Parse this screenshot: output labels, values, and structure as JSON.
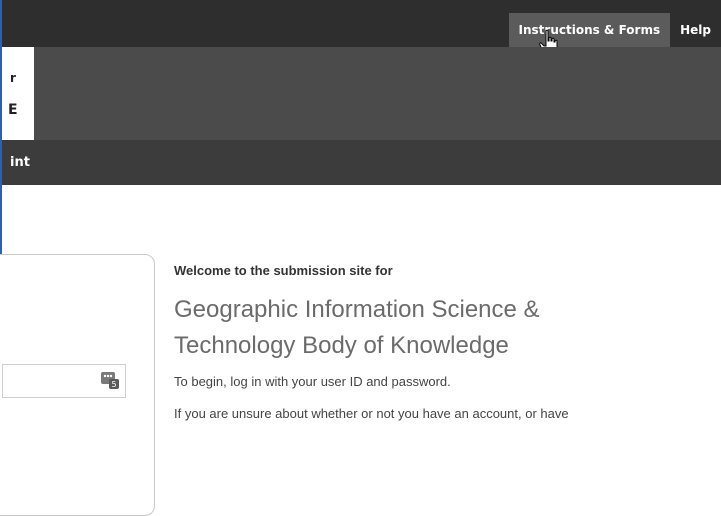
{
  "topnav": {
    "items": [
      {
        "label": "Instructions & Forms",
        "active": true
      },
      {
        "label": "Help",
        "active": false
      }
    ]
  },
  "logo": {
    "line1": "r",
    "line2": "E"
  },
  "subnav": {
    "item": "int"
  },
  "login": {
    "userid_value": ""
  },
  "welcome": {
    "lead": "Welcome to the submission site for",
    "title_line1": "Geographic Information Science &",
    "title_line2": "Technology Body of Knowledge",
    "para1": "To begin, log in with your user ID and password.",
    "para2": "If you are unsure about whether or not you have an account, or have"
  },
  "colors": {
    "topbar": "#2e2e2e",
    "header_band": "#4b4b4b",
    "subnav": "#3c3c3c",
    "active_tab": "#5b5b5b",
    "title_text": "#6b6b6b"
  },
  "icons": [
    "hand-pointer-cursor-icon",
    "password-key-icon"
  ]
}
